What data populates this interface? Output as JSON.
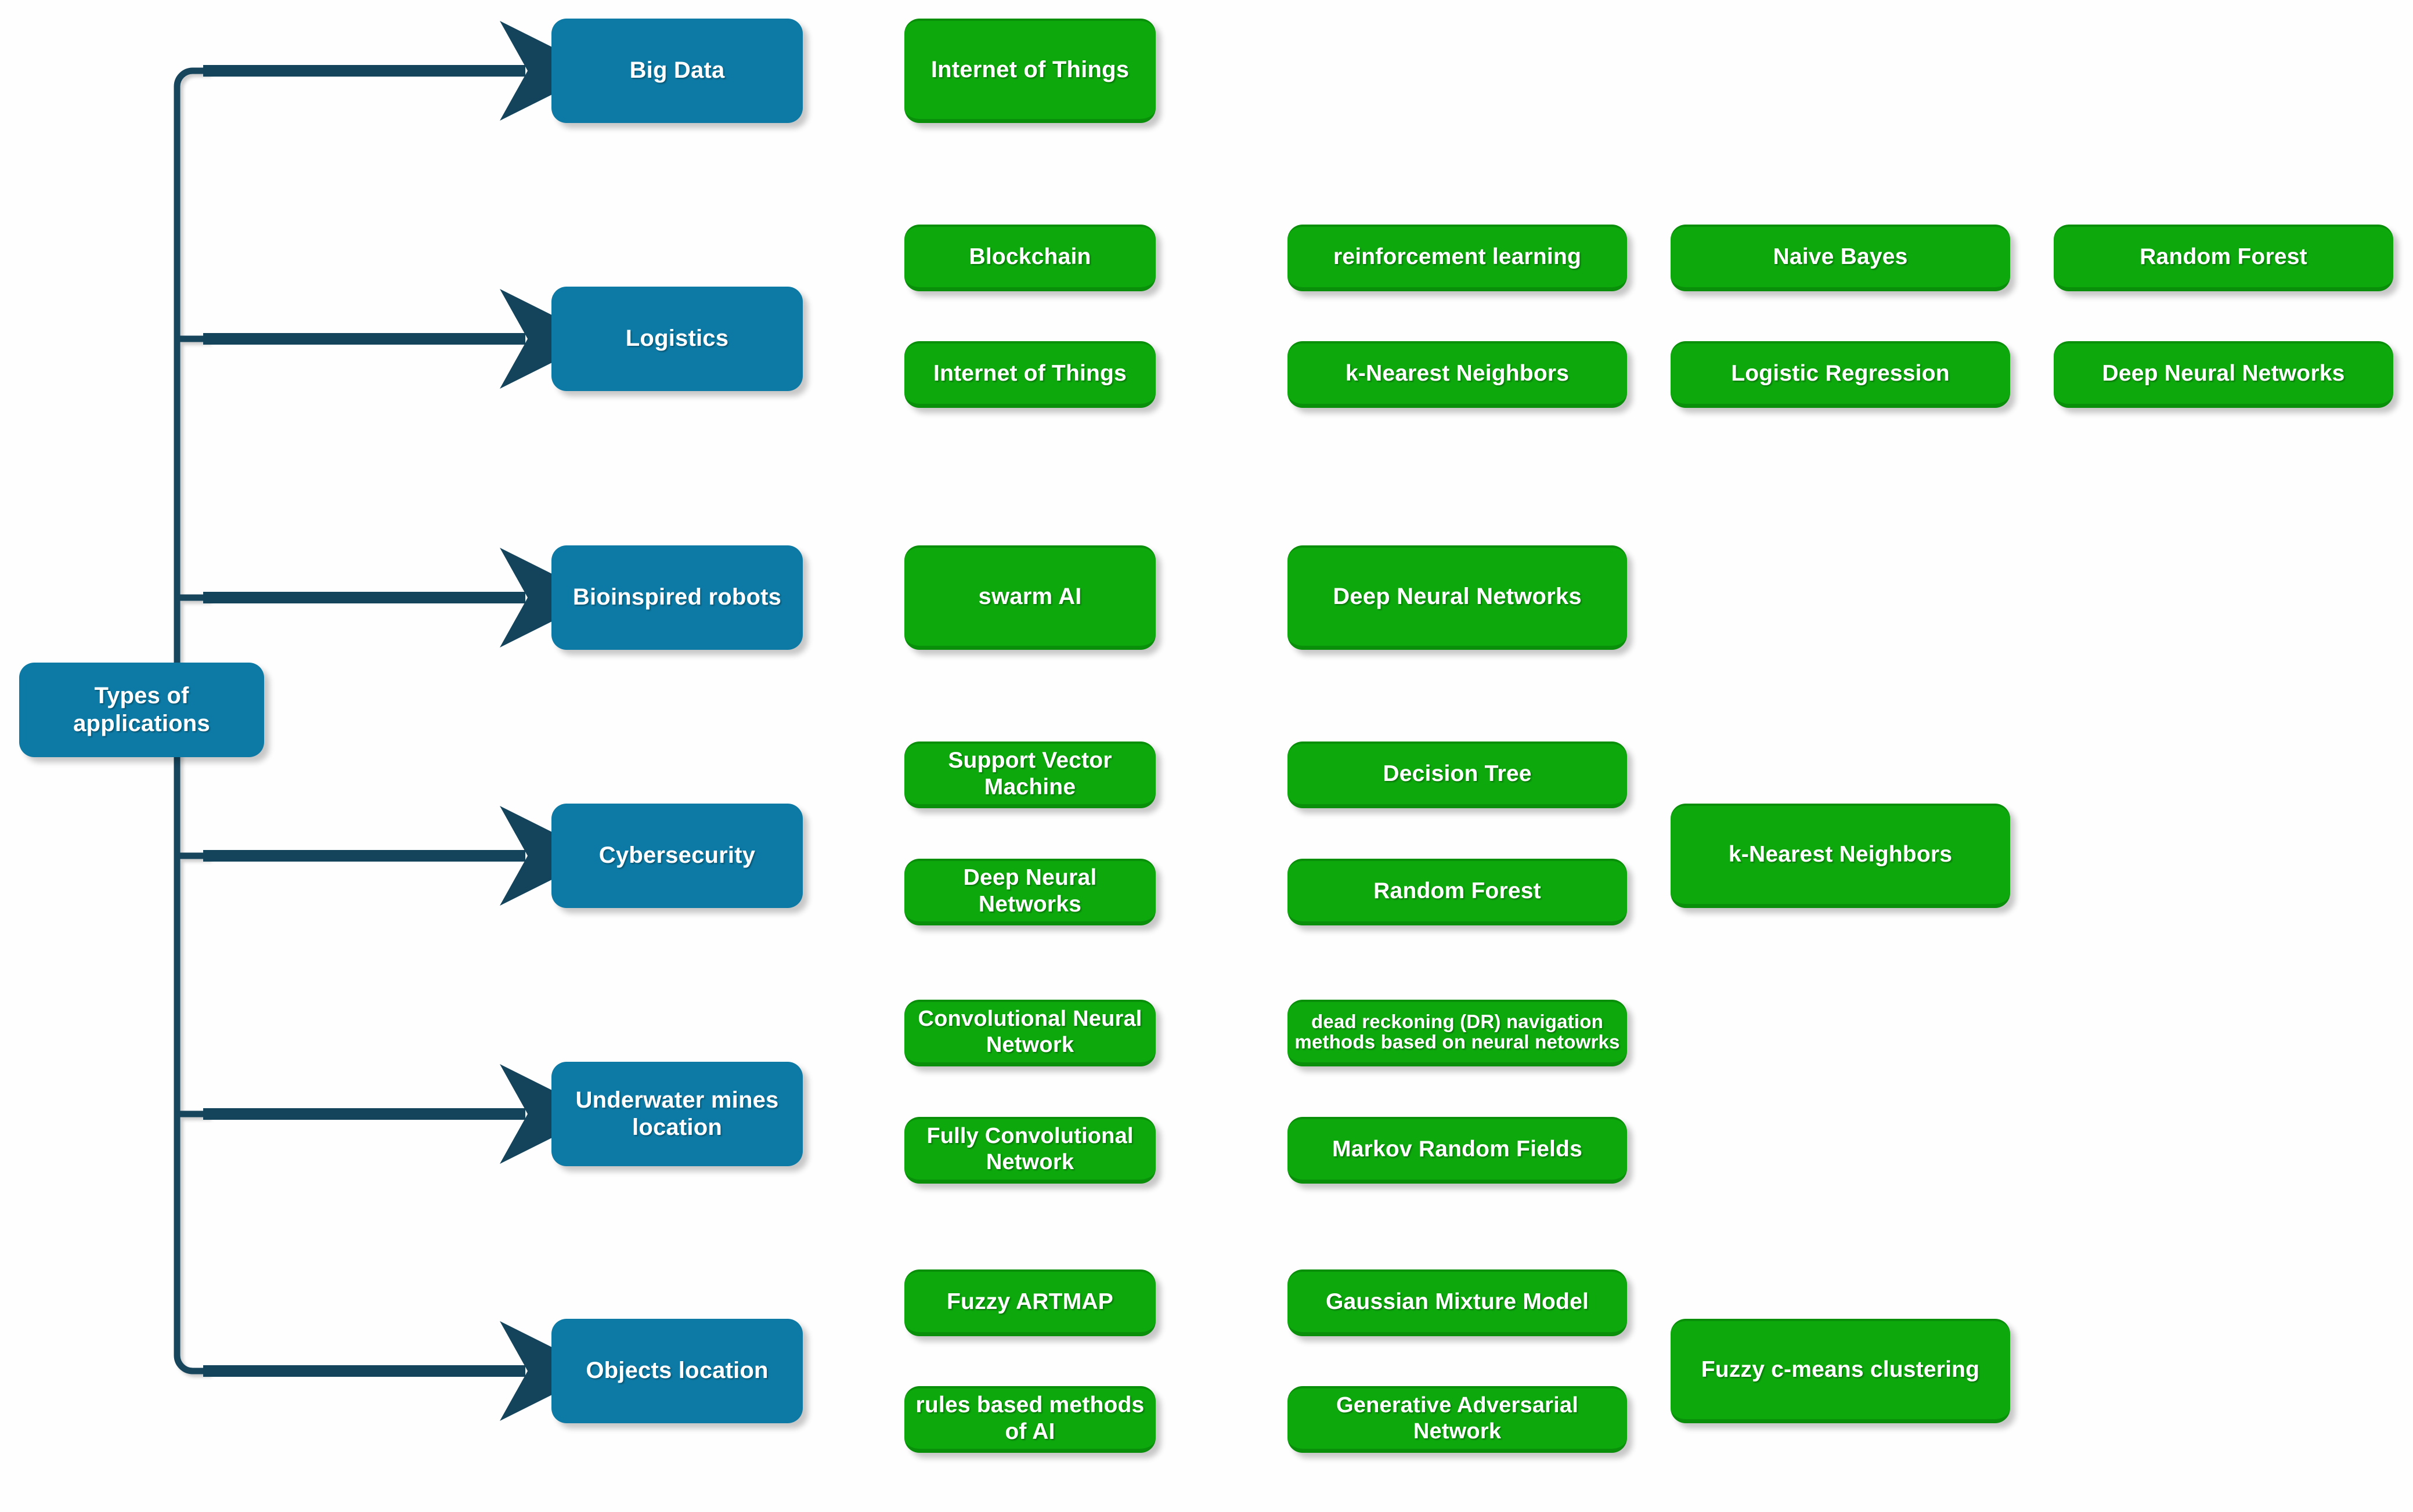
{
  "diagram": {
    "title_node": {
      "label": "Types of applications"
    },
    "colors": {
      "root_fill": "#0c7aa5",
      "category_fill": "#0c7aa5",
      "method_fill": "#0ca80c",
      "method_edge": "#0a8f0a",
      "connector": "#13445c",
      "text": "#ffffff",
      "background": "#fefefe"
    },
    "rows": [
      {
        "category": "Big Data",
        "methods": [
          "Internet of Things"
        ]
      },
      {
        "category": "Logistics",
        "methods": [
          "Blockchain",
          "reinforcement learning",
          "Naive Bayes",
          "Random Forest",
          "Internet of Things",
          "k-Nearest Neighbors",
          "Logistic Regression",
          "Deep Neural Networks"
        ]
      },
      {
        "category": "Bioinspired robots",
        "methods": [
          "swarm AI",
          "Deep Neural Networks"
        ]
      },
      {
        "category": "Cybersecurity",
        "methods": [
          "Support Vector Machine",
          "Decision Tree",
          "k-Nearest Neighbors",
          "Deep Neural Networks",
          "Random Forest"
        ]
      },
      {
        "category": "Underwater mines location",
        "methods": [
          "Convolutional Neural Network",
          "dead reckoning (DR) navigation methods based on neural netowrks",
          "Fully Convolutional Network",
          "Markov Random Fields"
        ]
      },
      {
        "category": "Objects location",
        "methods": [
          "Fuzzy ARTMAP",
          "Gaussian Mixture Model",
          "Fuzzy c-means clustering",
          "rules based methods of AI",
          "Generative Adversarial Network"
        ]
      }
    ],
    "nodes": {
      "r0c0": "Internet of Things",
      "r1c0": "Blockchain",
      "r1c1": "reinforcement learning",
      "r1c2": "Naive Bayes",
      "r1c3": "Random Forest",
      "r1c0b": "Internet of Things",
      "r1c1b": "k-Nearest Neighbors",
      "r1c2b": "Logistic Regression",
      "r1c3b": "Deep Neural Networks",
      "r2c0": "swarm AI",
      "r2c1": "Deep Neural Networks",
      "r3c0": "Support Vector Machine",
      "r3c1": "Decision Tree",
      "r3c2": "k-Nearest Neighbors",
      "r3c0b": "Deep Neural Networks",
      "r3c1b": "Random Forest",
      "r4c0": "Convolutional Neural Network",
      "r4c1": "dead reckoning (DR) navigation methods based on neural netowrks",
      "r4c0b": "Fully Convolutional Network",
      "r4c1b": "Markov Random Fields",
      "r5c0": "Fuzzy ARTMAP",
      "r5c1": "Gaussian Mixture Model",
      "r5c2": "Fuzzy c-means clustering",
      "r5c0b": "rules based methods of AI",
      "r5c1b": "Generative Adversarial Network"
    },
    "categories": {
      "c0": "Big Data",
      "c1": "Logistics",
      "c2": "Bioinspired robots",
      "c3": "Cybersecurity",
      "c4": "Underwater mines location",
      "c5": "Objects location"
    }
  }
}
